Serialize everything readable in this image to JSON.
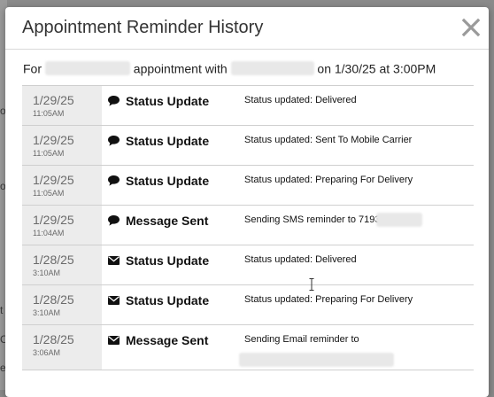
{
  "modal": {
    "title": "Appointment Reminder History",
    "close_icon": "close-icon"
  },
  "intro": {
    "prefix": "For",
    "middle": "appointment with",
    "suffix": "on 1/30/25 at 3:00PM"
  },
  "rows": [
    {
      "date": "1/29/25",
      "time": "11:05AM",
      "icon": "chat-bubble-icon",
      "type": "Status Update",
      "detail": "Status updated: Delivered"
    },
    {
      "date": "1/29/25",
      "time": "11:05AM",
      "icon": "chat-bubble-icon",
      "type": "Status Update",
      "detail": "Status updated: Sent To Mobile Carrier"
    },
    {
      "date": "1/29/25",
      "time": "11:05AM",
      "icon": "chat-bubble-icon",
      "type": "Status Update",
      "detail": "Status updated: Preparing For Delivery"
    },
    {
      "date": "1/29/25",
      "time": "11:04AM",
      "icon": "chat-bubble-icon",
      "type": "Message Sent",
      "detail": "Sending SMS reminder to 7193"
    },
    {
      "date": "1/28/25",
      "time": "3:10AM",
      "icon": "envelope-icon",
      "type": "Status Update",
      "detail": "Status updated: Delivered"
    },
    {
      "date": "1/28/25",
      "time": "3:10AM",
      "icon": "envelope-icon",
      "type": "Status Update",
      "detail": "Status updated: Preparing For Delivery"
    },
    {
      "date": "1/28/25",
      "time": "3:06AM",
      "icon": "envelope-icon",
      "type": "Message Sent",
      "detail": "Sending Email reminder to"
    }
  ],
  "background": {
    "letters": [
      "o",
      "o",
      "t",
      "C",
      "e"
    ]
  }
}
